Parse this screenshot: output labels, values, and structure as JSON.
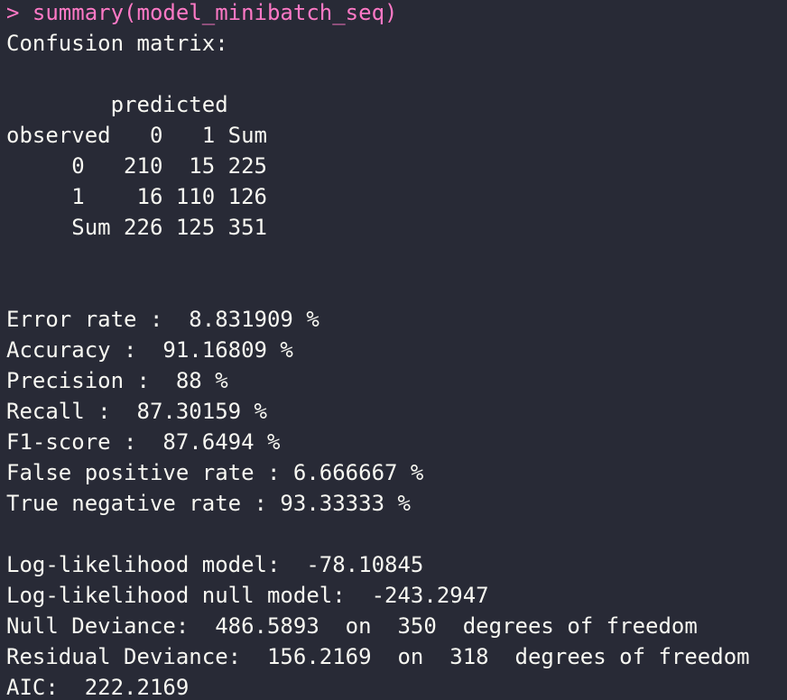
{
  "colors": {
    "background": "#282a36",
    "text": "#f8f8f2",
    "prompt": "#ff79c6"
  },
  "terminal": {
    "command": "> summary(model_minibatch_seq)",
    "lines": [
      "Confusion matrix:",
      "",
      "        predicted",
      "observed   0   1 Sum",
      "     0   210  15 225",
      "     1    16 110 126",
      "     Sum 226 125 351",
      "",
      "",
      "Error rate :  8.831909 %",
      "Accuracy :  91.16809 %",
      "Precision :  88 %",
      "Recall :  87.30159 %",
      "F1-score :  87.6494 %",
      "False positive rate : 6.666667 %",
      "True negative rate : 93.33333 %",
      "",
      "Log-likelihood model:  -78.10845",
      "Log-likelihood null model:  -243.2947",
      "Null Deviance:  486.5893  on  350  degrees of freedom",
      "Residual Deviance:  156.2169  on  318  degrees of freedom",
      "AIC:  222.2169"
    ]
  }
}
